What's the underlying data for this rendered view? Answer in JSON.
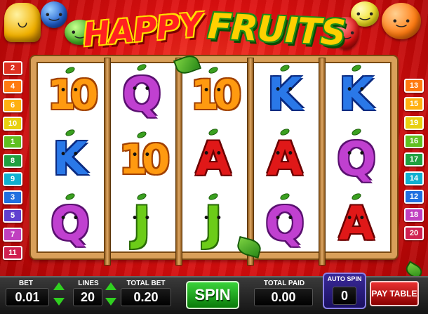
{
  "header": {
    "logo_word1": "HAPPY",
    "logo_word2": "FRUITS"
  },
  "reels": [
    [
      "10",
      "K",
      "Q"
    ],
    [
      "Q",
      "10",
      "J"
    ],
    [
      "10",
      "A",
      "J"
    ],
    [
      "K",
      "A",
      "Q"
    ],
    [
      "K",
      "Q",
      "A"
    ]
  ],
  "paylines": {
    "left": [
      {
        "label": "2",
        "color": "#e03020"
      },
      {
        "label": "4",
        "color": "#ff7a10"
      },
      {
        "label": "6",
        "color": "#ffb010"
      },
      {
        "label": "10",
        "color": "#e8d010"
      },
      {
        "label": "1",
        "color": "#60c020"
      },
      {
        "label": "8",
        "color": "#20a040"
      },
      {
        "label": "9",
        "color": "#10b0d0"
      },
      {
        "label": "3",
        "color": "#2070e0"
      },
      {
        "label": "5",
        "color": "#6040d0"
      },
      {
        "label": "7",
        "color": "#c040c0"
      },
      {
        "label": "11",
        "color": "#d02050"
      }
    ],
    "right": [
      {
        "label": "13",
        "color": "#ff7a10"
      },
      {
        "label": "15",
        "color": "#ffb010"
      },
      {
        "label": "19",
        "color": "#e8d010"
      },
      {
        "label": "16",
        "color": "#60c020"
      },
      {
        "label": "17",
        "color": "#20a040"
      },
      {
        "label": "14",
        "color": "#10b0d0"
      },
      {
        "label": "12",
        "color": "#2070e0"
      },
      {
        "label": "18",
        "color": "#c040c0"
      },
      {
        "label": "20",
        "color": "#d02050"
      }
    ]
  },
  "controls": {
    "bet_label": "BET",
    "bet_value": "0.01",
    "lines_label": "LINES",
    "lines_value": "20",
    "total_bet_label": "TOTAL BET",
    "total_bet_value": "0.20",
    "spin_label": "SPIN",
    "total_paid_label": "TOTAL PAID",
    "total_paid_value": "0.00",
    "auto_spin_label": "AUTO SPIN",
    "auto_spin_value": "0",
    "pay_table_label": "PAY TABLE"
  }
}
